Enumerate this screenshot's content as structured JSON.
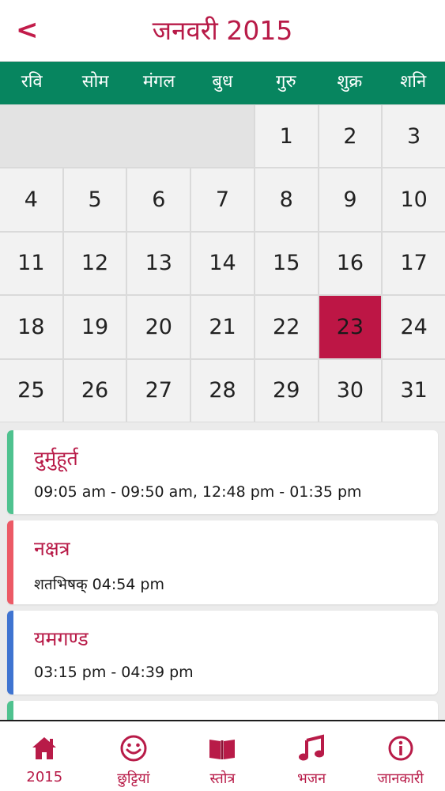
{
  "header": {
    "title": "जनवरी 2015",
    "back_glyph": "<"
  },
  "weekdays": [
    "रवि",
    "सोम",
    "मंगल",
    "बुध",
    "गुरु",
    "शुक्र",
    "शनि"
  ],
  "calendar": {
    "month": "जनवरी",
    "year": "2015",
    "selected_day": "23",
    "days": [
      "1",
      "2",
      "3",
      "4",
      "5",
      "6",
      "7",
      "8",
      "9",
      "10",
      "11",
      "12",
      "13",
      "14",
      "15",
      "16",
      "17",
      "18",
      "19",
      "20",
      "21",
      "22",
      "23",
      "24",
      "25",
      "26",
      "27",
      "28",
      "29",
      "30",
      "31"
    ]
  },
  "cards": [
    {
      "title": "दुर्मुहूर्त",
      "value": "09:05 am - 09:50 am, 12:48 pm - 01:35 pm",
      "color": "#4fc28f"
    },
    {
      "title": "नक्षत्र",
      "value": "शतभिषक् 04:54 pm",
      "color": "#ec5a66"
    },
    {
      "title": "यमगण्ड",
      "value": "03:15 pm - 04:39 pm",
      "color": "#3f74d1"
    },
    {
      "title": "",
      "value": "",
      "color": "#4fc28f"
    }
  ],
  "tabs": [
    {
      "label": "2015",
      "icon": "home-icon"
    },
    {
      "label": "छुट्टियां",
      "icon": "smiley-icon"
    },
    {
      "label": "स्तोत्र",
      "icon": "book-icon"
    },
    {
      "label": "भजन",
      "icon": "music-icon"
    },
    {
      "label": "जानकारी",
      "icon": "info-icon"
    }
  ],
  "colors": {
    "accent": "#b81b48",
    "weekday_bar": "#07855f",
    "selected_day": "#bd1645"
  }
}
